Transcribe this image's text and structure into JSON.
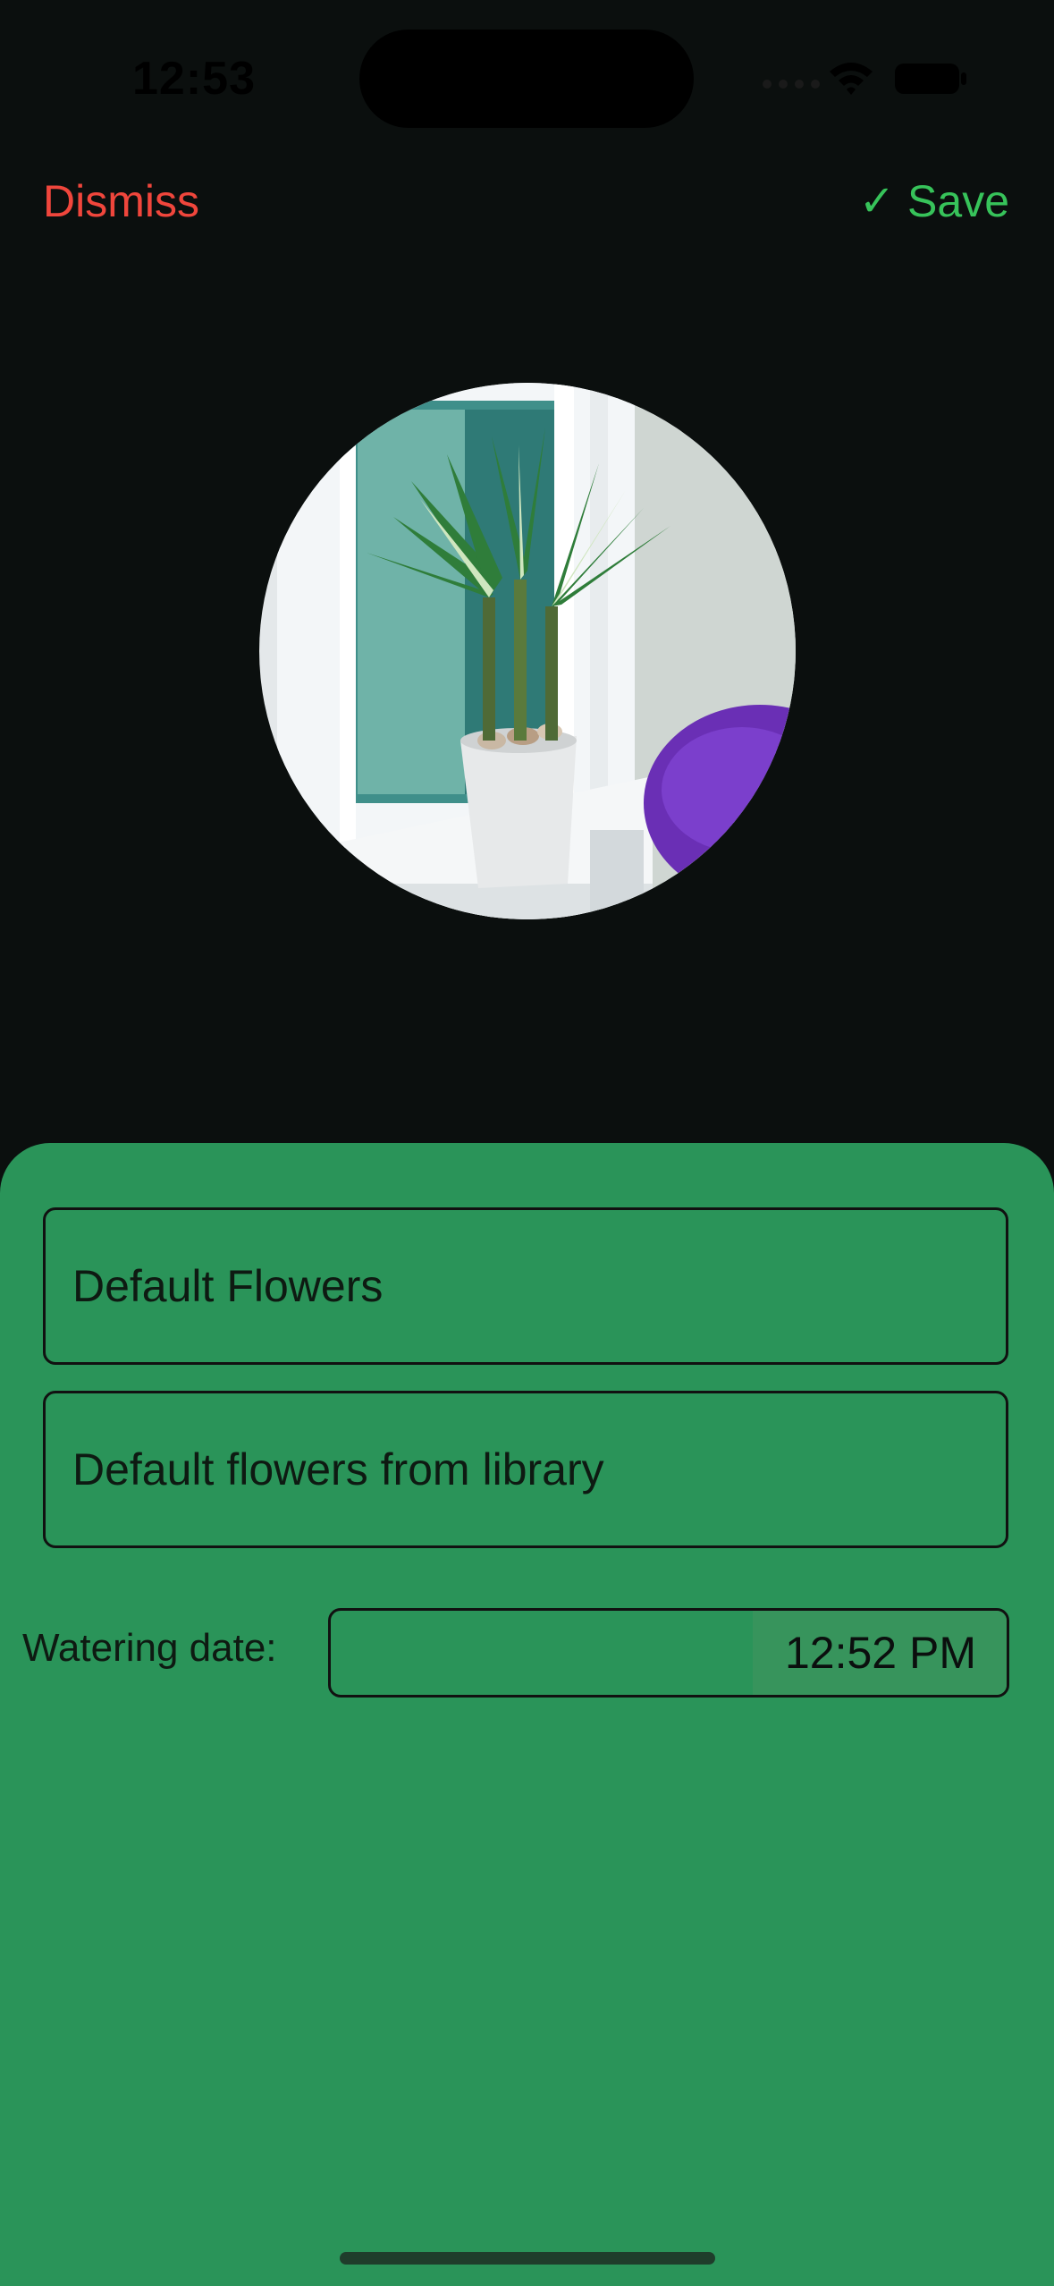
{
  "status_bar": {
    "time": "12:53",
    "icons": [
      "cellular-signal-icon",
      "wifi-icon",
      "battery-icon"
    ]
  },
  "nav": {
    "dismiss_label": "Dismiss",
    "save_check": "✓",
    "save_label": "Save"
  },
  "plant_photo": {
    "alt": "potted lucky bamboo plant on a window sill"
  },
  "form": {
    "name_value": "Default Flowers",
    "description_value": "Default flowers from library",
    "watering_label": "Watering date:",
    "watering_time": "12:52 PM"
  },
  "colors": {
    "background": "#0b0f0e",
    "sheet": "#2a9459",
    "dismiss": "#f0463c",
    "save": "#37c35a"
  }
}
